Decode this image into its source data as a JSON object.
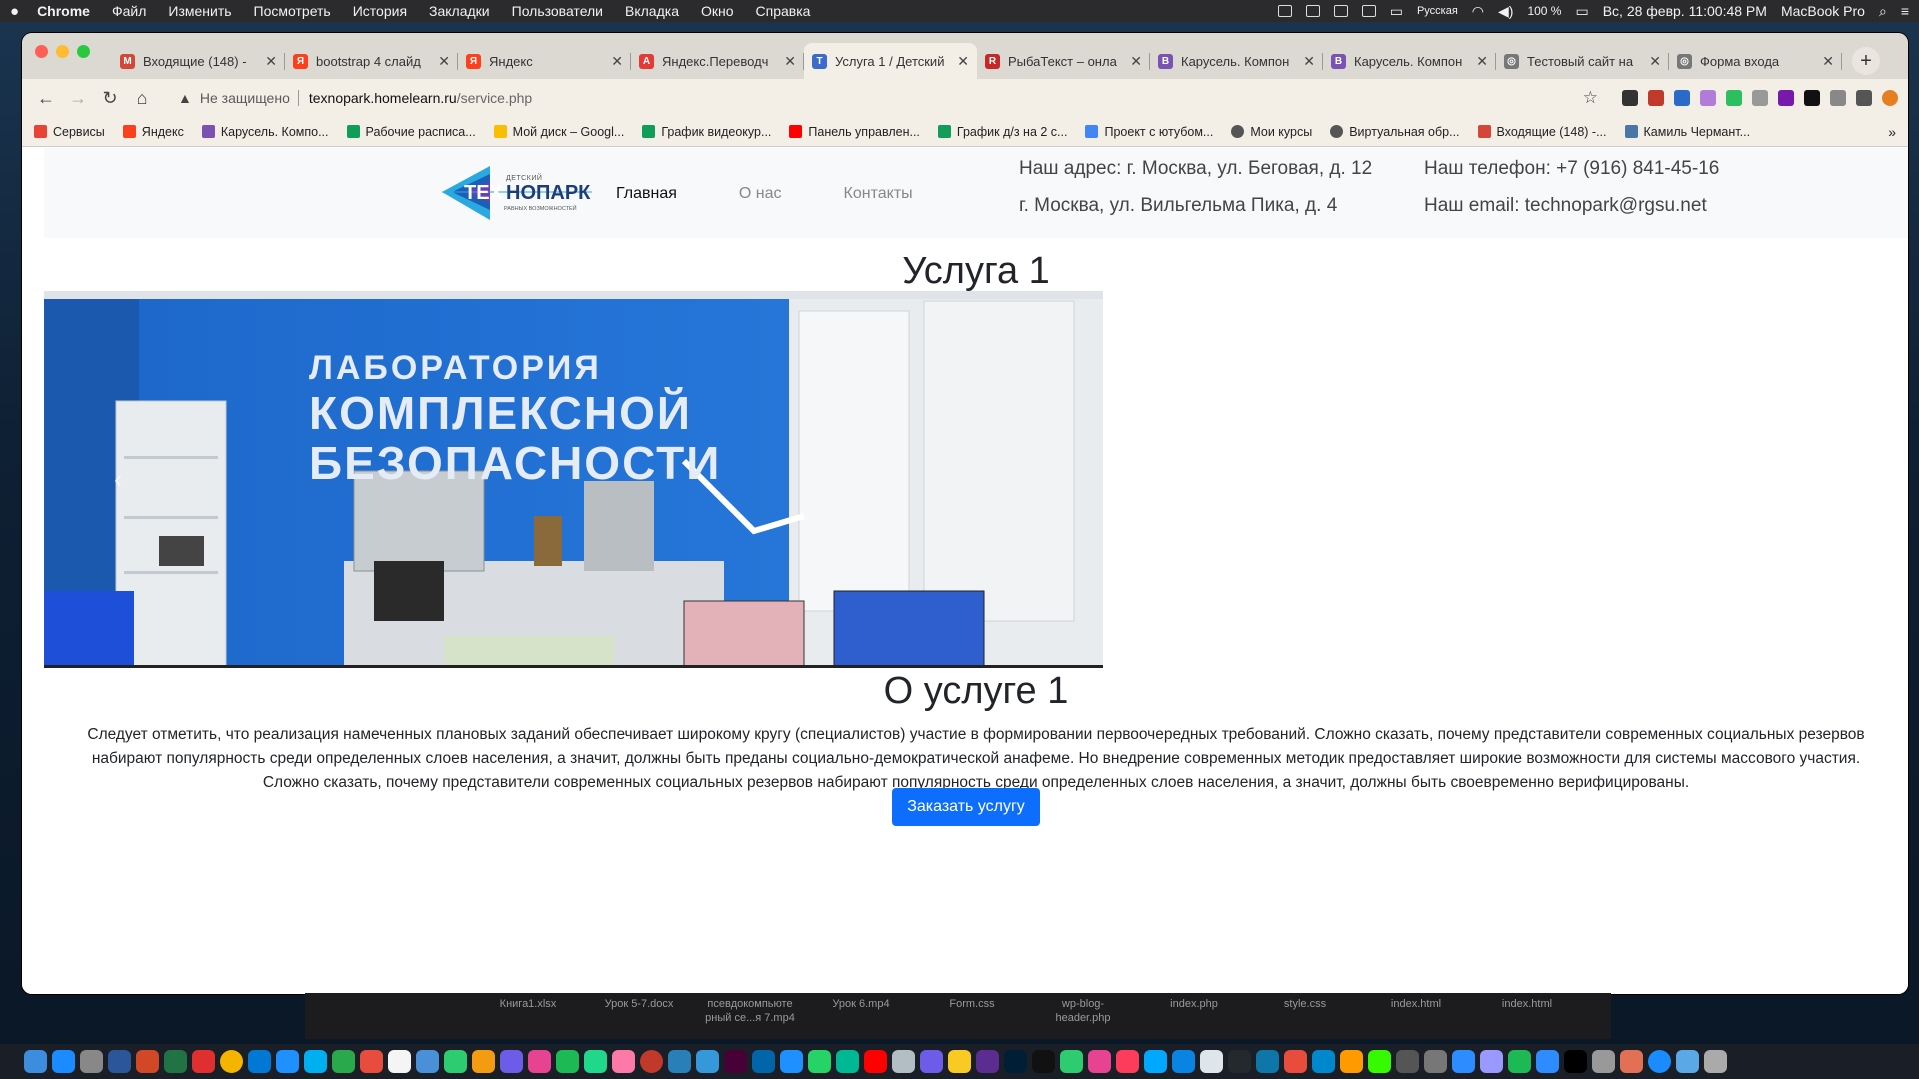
{
  "menubar": {
    "app": "Chrome",
    "items": [
      "Файл",
      "Изменить",
      "Посмотреть",
      "История",
      "Закладки",
      "Пользователи",
      "Вкладка",
      "Окно",
      "Справка"
    ],
    "input_lang": "Русская",
    "battery": "100 %",
    "datetime": "Вс, 28 февр.  11:00:48 PM",
    "computer": "MacBook Pro"
  },
  "tabs": [
    {
      "title": "Входящие (148) - ",
      "color": "#d44638",
      "glyph": "M"
    },
    {
      "title": "bootstrap 4 слайд",
      "color": "#fc3f1d",
      "glyph": "Я"
    },
    {
      "title": "Яндекс",
      "color": "#fc3f1d",
      "glyph": "Я"
    },
    {
      "title": "Яндекс.Переводч",
      "color": "#e53935",
      "glyph": "A"
    },
    {
      "title": "Услуга 1 / Детский",
      "color": "#3b6cc9",
      "glyph": "T",
      "active": true
    },
    {
      "title": "РыбаТекст – онла",
      "color": "#c62828",
      "glyph": "R"
    },
    {
      "title": "Карусель. Компон",
      "color": "#7952b3",
      "glyph": "B"
    },
    {
      "title": "Карусель. Компон",
      "color": "#7952b3",
      "glyph": "B"
    },
    {
      "title": "Тестовый сайт на",
      "color": "#777777",
      "glyph": "◎"
    },
    {
      "title": "Форма входа",
      "color": "#777777",
      "glyph": "◎"
    }
  ],
  "omnibox": {
    "security": "Не защищено",
    "host": "texnopark.homelearn.ru",
    "path": "/service.php"
  },
  "bookmarks": [
    {
      "label": "Сервисы",
      "color": "#ea4335"
    },
    {
      "label": "Яндекс",
      "color": "#fc3f1d"
    },
    {
      "label": "Карусель. Компо...",
      "color": "#7952b3"
    },
    {
      "label": "Рабочие расписа...",
      "color": "#0f9d58"
    },
    {
      "label": "Мой диск – Googl...",
      "color": "#fbbc04"
    },
    {
      "label": "График видеокур...",
      "color": "#0f9d58"
    },
    {
      "label": "Панель управлен...",
      "color": "#ff0000"
    },
    {
      "label": "График д/з на 2 с...",
      "color": "#0f9d58"
    },
    {
      "label": "Проект с ютубом...",
      "color": "#4285f4"
    },
    {
      "label": "Мои курсы",
      "color": "#555555"
    },
    {
      "label": "Виртуальная обр...",
      "color": "#555555"
    },
    {
      "label": "Входящие (148) -...",
      "color": "#d44638"
    },
    {
      "label": "Камиль Чермант...",
      "color": "#4a76a8"
    }
  ],
  "site": {
    "logo_small": "ДЕТСКИЙ",
    "logo_main_1": "ТЕХ",
    "logo_main_2": "НОПАРК",
    "logo_tagline": "РАВНЫХ ВОЗМОЖНОСТЕЙ",
    "nav": [
      "Главная",
      "О нас",
      "Контакты"
    ],
    "address_1": "Наш адрес: г. Москва, ул. Беговая, д. 12",
    "address_2": "г. Москва, ул. Вильгельма Пика, д. 4",
    "phone": "Наш телефон: +7 (916) 841-45-16",
    "email": "Наш email: technopark@rgsu.net"
  },
  "service": {
    "title": "Услуга 1",
    "hero_line_1": "ЛАБОРАТОРИЯ",
    "hero_line_2": "КОМПЛЕКСНОЙ",
    "hero_line_3": "БЕЗОПАСНОСТИ",
    "about_title": "О услуге 1",
    "description": "Следует отметить, что реализация намеченных плановых заданий обеспечивает широкому кругу (специалистов) участие в формировании первоочередных требований. Сложно сказать, почему представители современных социальных резервов набирают популярность среди определенных слоев населения, а значит, должны быть преданы социально-демократической анафеме. Но внедрение современных методик предоставляет широкие возможности для системы массового участия. Сложно сказать, почему представители современных социальных резервов набирают популярность среди определенных слоев населения, а значит, должны быть своевременно верифицированы.",
    "button": "Заказать услугу"
  },
  "downloads": [
    {
      "line1": "Книга1.xlsx",
      "line2": ""
    },
    {
      "line1": "Урок 5-7.docx",
      "line2": ""
    },
    {
      "line1": "псевдокомпьюте",
      "line2": "рный се...я 7.mp4"
    },
    {
      "line1": "Урок 6.mp4",
      "line2": ""
    },
    {
      "line1": "Form.css",
      "line2": ""
    },
    {
      "line1": "wp-blog-",
      "line2": "header.php"
    },
    {
      "line1": "index.php",
      "line2": ""
    },
    {
      "line1": "style.css",
      "line2": ""
    },
    {
      "line1": "index.html",
      "line2": ""
    },
    {
      "line1": "index.html",
      "line2": ""
    }
  ]
}
